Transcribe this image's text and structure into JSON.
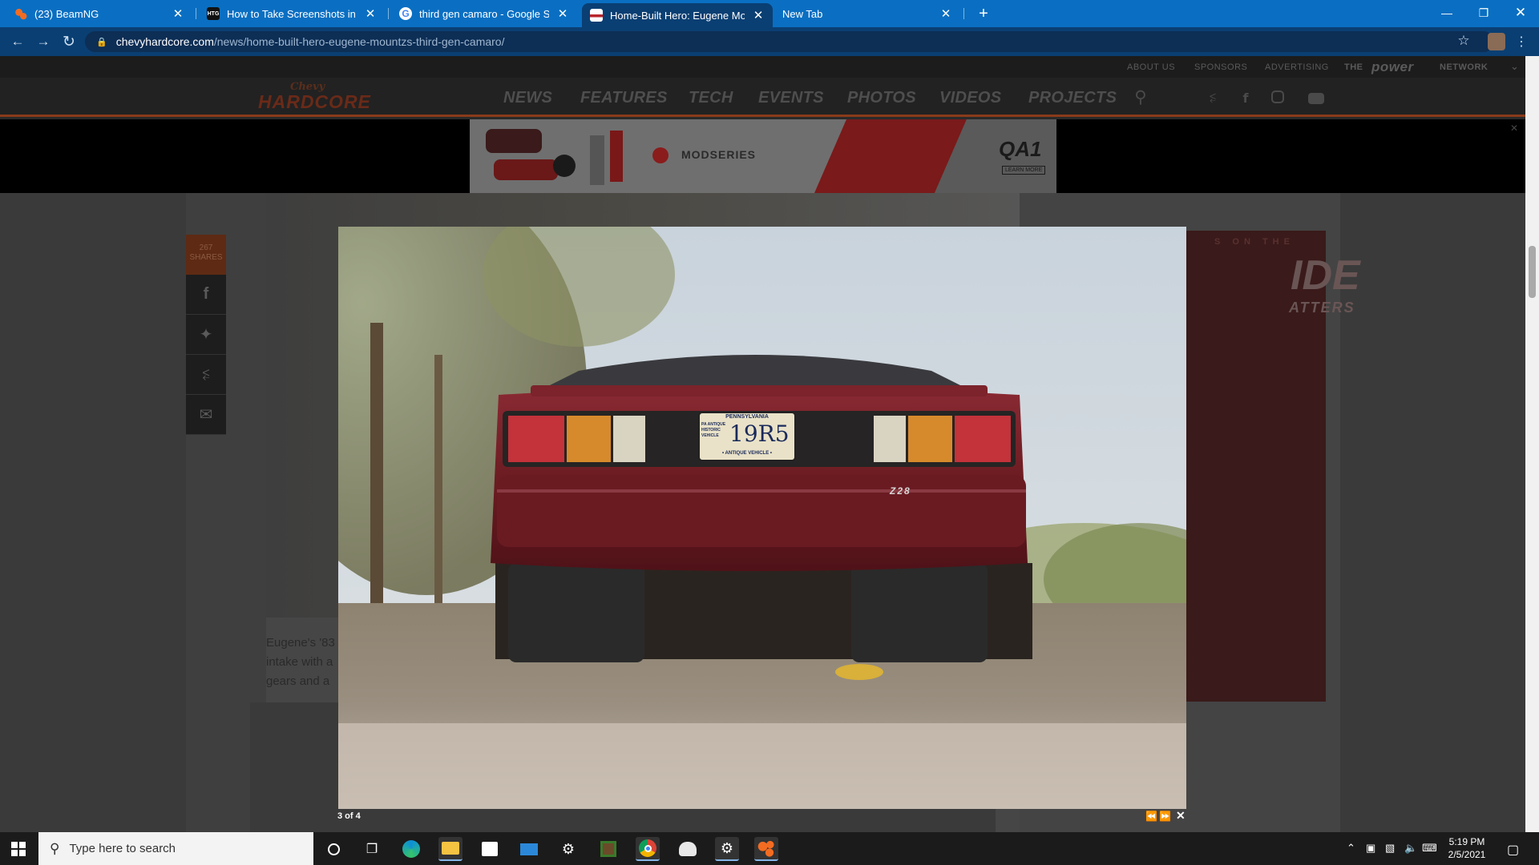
{
  "browser": {
    "tabs": [
      {
        "title": "(23) BeamNG",
        "active": false,
        "favicon": "beamng-icon"
      },
      {
        "title": "How to Take Screenshots in Windows",
        "active": false,
        "favicon": "htg-icon"
      },
      {
        "title": "third gen camaro - Google Search",
        "active": false,
        "favicon": "google-icon"
      },
      {
        "title": "Home-Built Hero: Eugene Mountz",
        "active": true,
        "favicon": "chevy-hardcore-icon"
      },
      {
        "title": "New Tab",
        "active": false,
        "favicon": ""
      }
    ],
    "new_tab_label": "+",
    "url_domain": "chevyhardcore.com",
    "url_path": "/news/home-built-hero-eugene-mountzs-third-gen-camaro/"
  },
  "site": {
    "top_links": [
      "ABOUT US",
      "SPONSORS",
      "ADVERTISING"
    ],
    "network_prefix": "THE",
    "network_brand": "power",
    "network_suffix": "NETWORK",
    "logo_top": "Chevy",
    "logo_main": "HARDCORE",
    "nav": [
      "NEWS",
      "FEATURES",
      "TECH",
      "EVENTS",
      "PHOTOS",
      "VIDEOS",
      "PROJECTS"
    ],
    "social_icons": [
      "rss-icon",
      "facebook-icon",
      "instagram-icon",
      "youtube-icon"
    ]
  },
  "ad": {
    "brand": "MODSERIES",
    "product": "QA1",
    "cta": "LEARN MORE"
  },
  "article": {
    "share_count": "267",
    "share_label": "SHARES",
    "caption_lines": [
      "Eugene's '83",
      "intake with a",
      "gears and a"
    ]
  },
  "side_ad": {
    "line1": "S ON THE",
    "line2": "IDE",
    "line3": "ATTERS"
  },
  "lightbox": {
    "counter": "3 of 4",
    "plate_state": "PENNSYLVANIA",
    "plate_number": "19R5",
    "plate_side": "PA ANTIQUE HISTORIC VEHICLE",
    "plate_bottom": "• ANTIQUE VEHICLE •",
    "badge": "Z28"
  },
  "taskbar": {
    "search_placeholder": "Type here to search",
    "time": "5:19 PM",
    "date": "2/5/2021"
  },
  "colors": {
    "tab_strip": "#0a6fc2",
    "toolbar": "#0a3f73",
    "accent_orange": "#8a3a1a",
    "car_red": "#7a1b22"
  }
}
